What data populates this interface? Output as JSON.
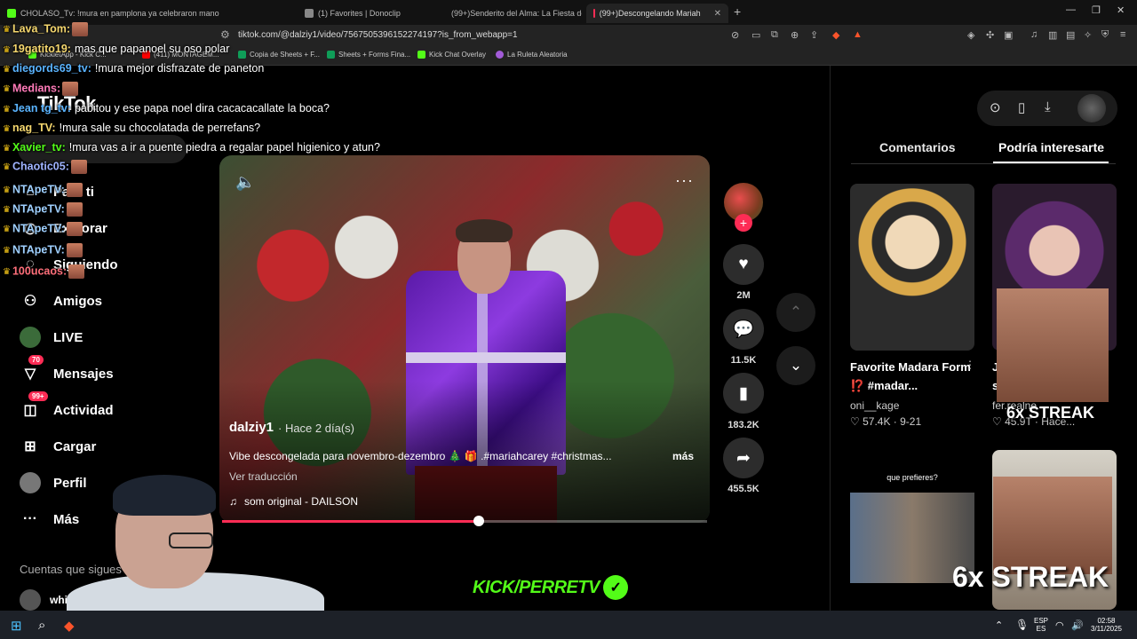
{
  "browser": {
    "tabs": [
      {
        "label": "CHOLASO_Tv: !mura en pamplona ya celebraron mano",
        "active": false
      },
      {
        "label": "(1) Favorites | Donoclip",
        "active": false
      },
      {
        "label": "(99+)Senderito del Alma: La Fiesta de",
        "active": false
      },
      {
        "label": "(99+)Descongelando Mariah",
        "active": true
      }
    ],
    "new_tab": "+",
    "url": "tiktok.com/@dalziy1/video/7567505396152274197?is_from_webapp=1",
    "bookmarks": [
      "KickletApp - Kick C...",
      "(411) MONTAGEM...",
      "Copia de Sheets + F...",
      "Sheets + Forms Fina...",
      "Kick Chat Overlay",
      "La Ruleta Aleatoria"
    ]
  },
  "chat": [
    {
      "user": "Lava_Tom:",
      "msg": "",
      "color": "#f5d76e"
    },
    {
      "user": "19gatito19:",
      "msg": "mas que papanoel su oso polar",
      "color": "#f5d76e"
    },
    {
      "user": "diegords69_tv:",
      "msg": "!mura mejor disfrazate de paneton",
      "color": "#5ab4ff"
    },
    {
      "user": "Medians:",
      "msg": "",
      "color": "#ff7ab8"
    },
    {
      "user": "Jean tg_tv:",
      "msg": "pabitou y ese papa noel dira cacacacallate la boca?",
      "color": "#5ab4ff"
    },
    {
      "user": "nag_TV:",
      "msg": "!mura sale su chocolatada de perrefans?",
      "color": "#f5d76e"
    },
    {
      "user": "Xavier_tv:",
      "msg": "!mura vas a ir a puente piedra a regalar papel higienico y atun?",
      "color": "#53fc18"
    },
    {
      "user": "Chaotic05:",
      "msg": "",
      "color": "#9fb3ff"
    },
    {
      "user": "NTApeTV:",
      "msg": "",
      "color": "#9fd0ff"
    },
    {
      "user": "NTApeTV:",
      "msg": "",
      "color": "#9fd0ff"
    },
    {
      "user": "NTApeTV:",
      "msg": "",
      "color": "#9fd0ff"
    },
    {
      "user": "NTApeTV:",
      "msg": "",
      "color": "#9fd0ff"
    },
    {
      "user": "100ucaos:",
      "msg": "",
      "color": "#ff6f7a"
    }
  ],
  "tiktok": {
    "logo": "TikTok",
    "sidebar": [
      {
        "label": "Para ti",
        "icon": "home-icon"
      },
      {
        "label": "Explorar",
        "icon": "compass-icon"
      },
      {
        "label": "Siguiendo",
        "icon": "following-icon"
      },
      {
        "label": "Amigos",
        "icon": "friends-icon"
      },
      {
        "label": "LIVE",
        "icon": "live-icon"
      },
      {
        "label": "Mensajes",
        "icon": "message-icon",
        "badge": "70"
      },
      {
        "label": "Actividad",
        "icon": "activity-icon",
        "badge": "99+"
      },
      {
        "label": "Cargar",
        "icon": "upload-icon"
      },
      {
        "label": "Perfil",
        "icon": "profile-icon"
      },
      {
        "label": "Más",
        "icon": "more-icon"
      }
    ],
    "following_title": "Cuentas que sigues",
    "following_user": "whiteboy"
  },
  "video": {
    "author": "dalziy1",
    "time": "· Hace 2 día(s)",
    "description": "Vibe descongelada para novembro-dezembro 🎄 🎁 .#mariahcarey #christmas...",
    "more": "más",
    "translate": "Ver traducción",
    "music": "som original - DAILSON",
    "progress": 0.53
  },
  "actions": {
    "likes": "2M",
    "comments": "11.5K",
    "saves": "183.2K",
    "shares": "455.5K"
  },
  "right_panel": {
    "tabs": [
      "Comentarios",
      "Podría interesarte"
    ],
    "active_tab": 1,
    "cards": [
      {
        "title": "Favorite Madara Form ⁉️ #madar...",
        "user": "oni__kage",
        "stats": "♡ 57.4K · 9-21"
      },
      {
        "title": "J... s...",
        "user": "fer.realne",
        "stats": "♡ 45.9T · Hace..."
      },
      {
        "title": "que prefieres?",
        "user": "",
        "stats": ""
      }
    ]
  },
  "overlay": {
    "streak_small": "6x STREAK",
    "streak_large": "6x STREAK",
    "kick_brand": "KICK/PERRETV"
  },
  "taskbar": {
    "lang": "ESP",
    "region": "ES",
    "time": "02:58",
    "date": "3/11/2025"
  }
}
